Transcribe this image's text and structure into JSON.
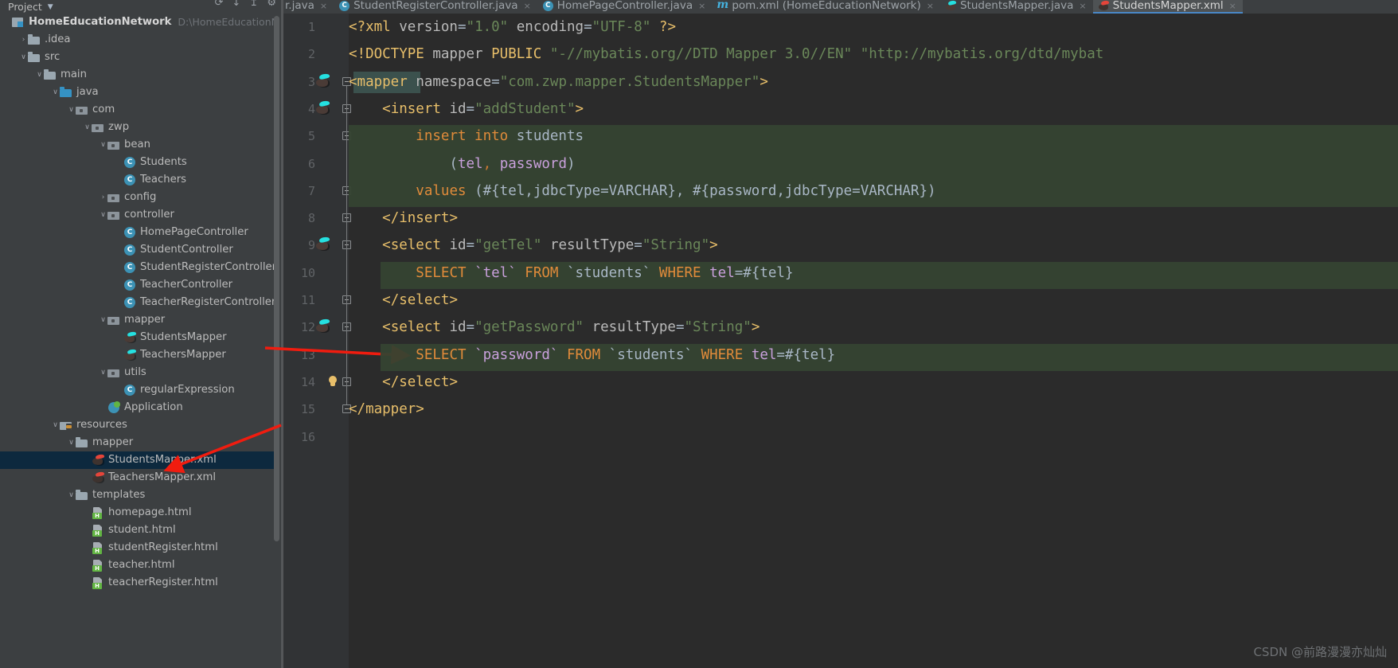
{
  "window": {
    "theme_bg": "#3c3f41",
    "editor_bg": "#2b2b2b",
    "accent": "#4a88c7",
    "selection_bg": "#0d293e",
    "annotation_color": "#f01c0f"
  },
  "sidebar": {
    "title": "Project",
    "toolbar_icons": [
      "sync-icon",
      "collapse-all-icon",
      "expand-all-icon",
      "gear-icon"
    ],
    "scrollbar": "vertical-scrollbar",
    "tree": [
      {
        "label": "HomeEducationNetwork",
        "sub": "D:\\HomeEducationNetw",
        "icon": "module-icon",
        "indent": 0,
        "arrow": "",
        "kind": "project"
      },
      {
        "label": ".idea",
        "sub": "",
        "icon": "folder-icon",
        "indent": 1,
        "arrow": "›",
        "kind": "folder"
      },
      {
        "label": "src",
        "sub": "",
        "icon": "folder-icon",
        "indent": 1,
        "arrow": "∨",
        "kind": "folder"
      },
      {
        "label": "main",
        "sub": "",
        "icon": "folder-icon",
        "indent": 2,
        "arrow": "∨",
        "kind": "folder"
      },
      {
        "label": "java",
        "sub": "",
        "icon": "source-folder-icon",
        "indent": 3,
        "arrow": "∨",
        "kind": "folder-blue"
      },
      {
        "label": "com",
        "sub": "",
        "icon": "package-icon",
        "indent": 4,
        "arrow": "∨",
        "kind": "package"
      },
      {
        "label": "zwp",
        "sub": "",
        "icon": "package-icon",
        "indent": 5,
        "arrow": "∨",
        "kind": "package"
      },
      {
        "label": "bean",
        "sub": "",
        "icon": "package-icon",
        "indent": 6,
        "arrow": "∨",
        "kind": "package"
      },
      {
        "label": "Students",
        "sub": "",
        "icon": "java-class-icon",
        "indent": 7,
        "arrow": "",
        "kind": "class"
      },
      {
        "label": "Teachers",
        "sub": "",
        "icon": "java-class-icon",
        "indent": 7,
        "arrow": "",
        "kind": "class"
      },
      {
        "label": "config",
        "sub": "",
        "icon": "package-icon",
        "indent": 6,
        "arrow": "›",
        "kind": "package"
      },
      {
        "label": "controller",
        "sub": "",
        "icon": "package-icon",
        "indent": 6,
        "arrow": "∨",
        "kind": "package"
      },
      {
        "label": "HomePageController",
        "sub": "",
        "icon": "java-class-icon",
        "indent": 7,
        "arrow": "",
        "kind": "class"
      },
      {
        "label": "StudentController",
        "sub": "",
        "icon": "java-class-icon",
        "indent": 7,
        "arrow": "",
        "kind": "class"
      },
      {
        "label": "StudentRegisterController",
        "sub": "",
        "icon": "java-class-icon",
        "indent": 7,
        "arrow": "",
        "kind": "class"
      },
      {
        "label": "TeacherController",
        "sub": "",
        "icon": "java-class-icon",
        "indent": 7,
        "arrow": "",
        "kind": "class"
      },
      {
        "label": "TeacherRegisterController",
        "sub": "",
        "icon": "java-class-icon",
        "indent": 7,
        "arrow": "",
        "kind": "class"
      },
      {
        "label": "mapper",
        "sub": "",
        "icon": "package-icon",
        "indent": 6,
        "arrow": "∨",
        "kind": "package"
      },
      {
        "label": "StudentsMapper",
        "sub": "",
        "icon": "mybatis-mapper-icon",
        "indent": 7,
        "arrow": "",
        "kind": "bird"
      },
      {
        "label": "TeachersMapper",
        "sub": "",
        "icon": "mybatis-mapper-icon",
        "indent": 7,
        "arrow": "",
        "kind": "bird"
      },
      {
        "label": "utils",
        "sub": "",
        "icon": "package-icon",
        "indent": 6,
        "arrow": "∨",
        "kind": "package"
      },
      {
        "label": "regularExpression",
        "sub": "",
        "icon": "java-class-icon",
        "indent": 7,
        "arrow": "",
        "kind": "class"
      },
      {
        "label": "Application",
        "sub": "",
        "icon": "spring-boot-run-icon",
        "indent": 6,
        "arrow": "",
        "kind": "app"
      },
      {
        "label": "resources",
        "sub": "",
        "icon": "resources-folder-icon",
        "indent": 3,
        "arrow": "∨",
        "kind": "resources"
      },
      {
        "label": "mapper",
        "sub": "",
        "icon": "folder-icon",
        "indent": 4,
        "arrow": "∨",
        "kind": "folder"
      },
      {
        "label": "StudentsMapper.xml",
        "sub": "",
        "icon": "mybatis-xml-icon",
        "indent": 5,
        "arrow": "",
        "kind": "birdx",
        "selected": true
      },
      {
        "label": "TeachersMapper.xml",
        "sub": "",
        "icon": "mybatis-xml-icon",
        "indent": 5,
        "arrow": "",
        "kind": "birdx"
      },
      {
        "label": "templates",
        "sub": "",
        "icon": "folder-icon",
        "indent": 4,
        "arrow": "∨",
        "kind": "folder"
      },
      {
        "label": "homepage.html",
        "sub": "",
        "icon": "html-file-icon",
        "indent": 5,
        "arrow": "",
        "kind": "html"
      },
      {
        "label": "student.html",
        "sub": "",
        "icon": "html-file-icon",
        "indent": 5,
        "arrow": "",
        "kind": "html"
      },
      {
        "label": "studentRegister.html",
        "sub": "",
        "icon": "html-file-icon",
        "indent": 5,
        "arrow": "",
        "kind": "html"
      },
      {
        "label": "teacher.html",
        "sub": "",
        "icon": "html-file-icon",
        "indent": 5,
        "arrow": "",
        "kind": "html"
      },
      {
        "label": "teacherRegister.html",
        "sub": "",
        "icon": "html-file-icon",
        "indent": 5,
        "arrow": "",
        "kind": "html"
      }
    ]
  },
  "tabs": [
    {
      "label": "r.java",
      "icon": "java-class-icon",
      "active": false,
      "truncated": true
    },
    {
      "label": "StudentRegisterController.java",
      "icon": "java-class-icon",
      "active": false
    },
    {
      "label": "HomePageController.java",
      "icon": "java-class-icon",
      "active": false
    },
    {
      "label": "pom.xml (HomeEducationNetwork)",
      "icon": "maven-icon",
      "active": false
    },
    {
      "label": "StudentsMapper.java",
      "icon": "mybatis-mapper-icon",
      "active": false
    },
    {
      "label": "StudentsMapper.xml",
      "icon": "mybatis-xml-icon",
      "active": true
    }
  ],
  "editor": {
    "file": "StudentsMapper.xml",
    "line_numbers": [
      1,
      2,
      3,
      4,
      5,
      6,
      7,
      8,
      9,
      10,
      11,
      12,
      13,
      14,
      15,
      16
    ],
    "gutter_icons": [
      {
        "line": 3,
        "icon": "mybatis-statement-icon"
      },
      {
        "line": 4,
        "icon": "mybatis-statement-icon"
      },
      {
        "line": 9,
        "icon": "mybatis-statement-icon"
      },
      {
        "line": 12,
        "icon": "mybatis-statement-icon"
      },
      {
        "line": 14,
        "icon": "intention-bulb-icon"
      }
    ],
    "lines": [
      {
        "n": 1,
        "text": "<?xml version=\"1.0\" encoding=\"UTF-8\" ?>"
      },
      {
        "n": 2,
        "text": "<!DOCTYPE mapper PUBLIC \"-//mybatis.org//DTD Mapper 3.0//EN\" \"http://mybatis.org/dtd/mybat"
      },
      {
        "n": 3,
        "text": "<mapper namespace=\"com.zwp.mapper.StudentsMapper\">"
      },
      {
        "n": 4,
        "text": "    <insert id=\"addStudent\">"
      },
      {
        "n": 5,
        "text": "        insert into students"
      },
      {
        "n": 6,
        "text": "            (tel, password)"
      },
      {
        "n": 7,
        "text": "        values (#{tel,jdbcType=VARCHAR}, #{password,jdbcType=VARCHAR})"
      },
      {
        "n": 8,
        "text": "    </insert>"
      },
      {
        "n": 9,
        "text": "    <select id=\"getTel\" resultType=\"String\">"
      },
      {
        "n": 10,
        "text": "        SELECT `tel` FROM `students` WHERE tel=#{tel}"
      },
      {
        "n": 11,
        "text": "    </select>"
      },
      {
        "n": 12,
        "text": "    <select id=\"getPassword\" resultType=\"String\">"
      },
      {
        "n": 13,
        "text": "        SELECT `password` FROM `students` WHERE tel=#{tel}"
      },
      {
        "n": 14,
        "text": "    </select>"
      },
      {
        "n": 15,
        "text": "</mapper>"
      },
      {
        "n": 16,
        "text": ""
      }
    ]
  },
  "annotations": {
    "tree_arrow": "red-arrow-pointing-to-students-mapper-xml",
    "code_arrow": "red-arrow-pointing-to-line-13"
  },
  "watermark": "CSDN @前路漫漫亦灿灿"
}
